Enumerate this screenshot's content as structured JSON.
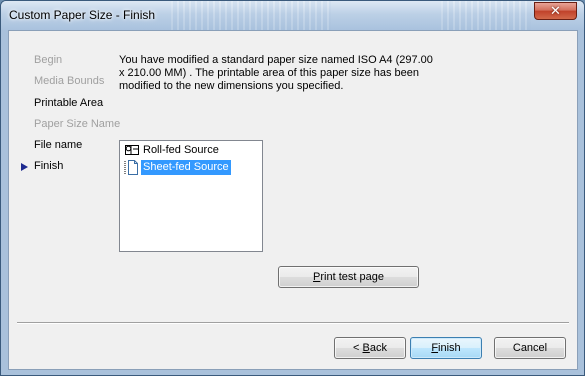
{
  "window": {
    "title": "Custom Paper Size - Finish",
    "close_symbol": "✕"
  },
  "steps": [
    {
      "label": "Begin",
      "state": "disabled"
    },
    {
      "label": "Media Bounds",
      "state": "disabled"
    },
    {
      "label": "Printable Area",
      "state": "enabled"
    },
    {
      "label": "Paper Size Name",
      "state": "disabled"
    },
    {
      "label": "File name",
      "state": "enabled"
    },
    {
      "label": "Finish",
      "state": "current"
    }
  ],
  "description": "You have modified a standard paper size named  ISO A4 (297.00 x 210.00 MM) . The printable area of this paper size has been modified to the new dimensions you specified.",
  "source_list": {
    "items": [
      {
        "label": "Roll-fed Source",
        "icon": "roll-fed-icon",
        "selected": false
      },
      {
        "label": "Sheet-fed Source",
        "icon": "sheet-fed-icon",
        "selected": true
      }
    ]
  },
  "buttons": {
    "print_test_prefix": "P",
    "print_test_rest": "rint test page",
    "back_prefix": "< ",
    "back_mnemonic": "B",
    "back_rest": "ack",
    "finish_mnemonic": "F",
    "finish_rest": "inish",
    "cancel": "Cancel"
  },
  "colors": {
    "selection": "#3399ff",
    "current_arrow": "#1d2a8f",
    "disabled_text": "#a0a0a0"
  }
}
